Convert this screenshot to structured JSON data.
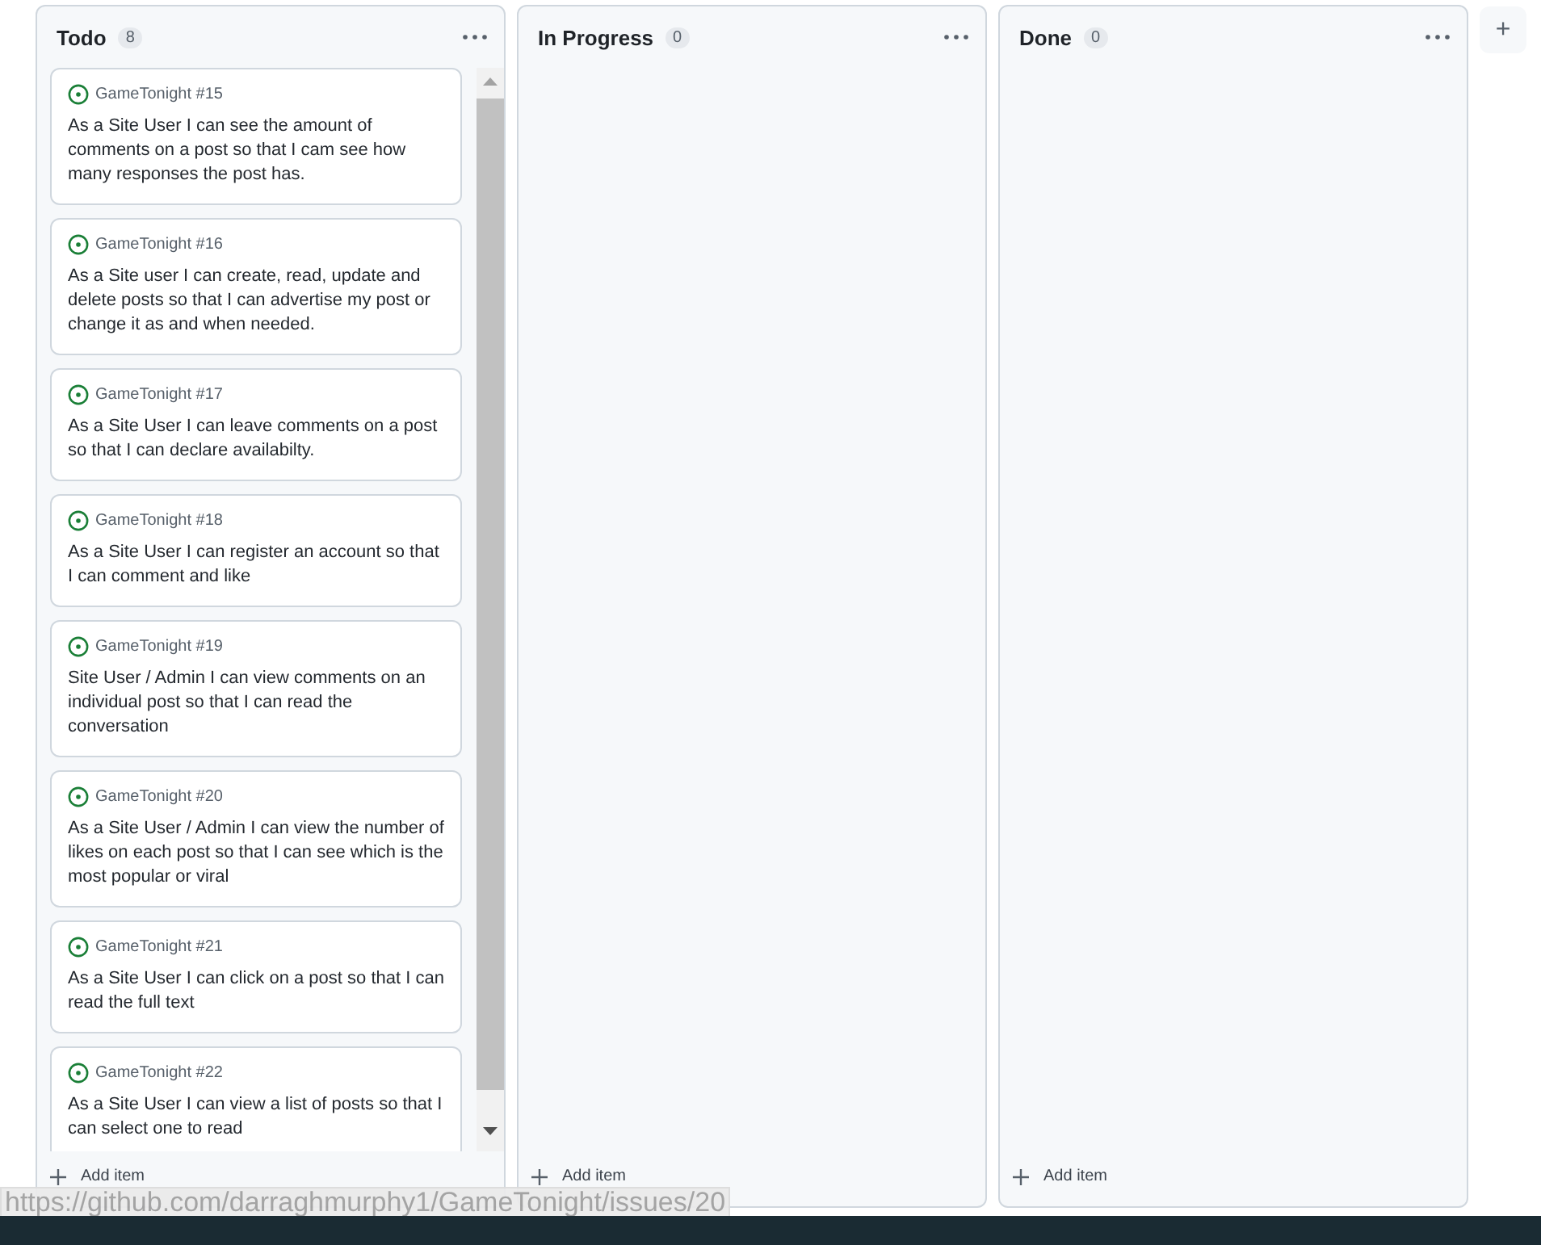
{
  "columns": [
    {
      "title": "Todo",
      "count": "8",
      "add_label": "Add item",
      "cards": [
        {
          "repo": "GameTonight #15",
          "text": "As a Site User I can see the amount of comments on a post so that I cam see how many responses the post has."
        },
        {
          "repo": "GameTonight #16",
          "text": "As a Site user I can create, read, update and delete posts so that I can advertise my post or change it as and when needed."
        },
        {
          "repo": "GameTonight #17",
          "text": "As a Site User I can leave comments on a post so that I can declare availabilty."
        },
        {
          "repo": "GameTonight #18",
          "text": "As a Site User I can register an account so that I can comment and like"
        },
        {
          "repo": "GameTonight #19",
          "text": "Site User / Admin I can view comments on an individual post so that I can read the conversation"
        },
        {
          "repo": "GameTonight #20",
          "text": "As a Site User / Admin I can view the number of likes on each post so that I can see which is the most popular or viral"
        },
        {
          "repo": "GameTonight #21",
          "text": "As a Site User I can click on a post so that I can read the full text"
        },
        {
          "repo": "GameTonight #22",
          "text": "As a Site User I can view a list of posts so that I can select one to read"
        }
      ]
    },
    {
      "title": "In Progress",
      "count": "0",
      "add_label": "Add item"
    },
    {
      "title": "Done",
      "count": "0",
      "add_label": "Add item"
    }
  ],
  "add_column": "+",
  "status_url": "https://github.com/darraghmurphy1/GameTonight/issues/20"
}
